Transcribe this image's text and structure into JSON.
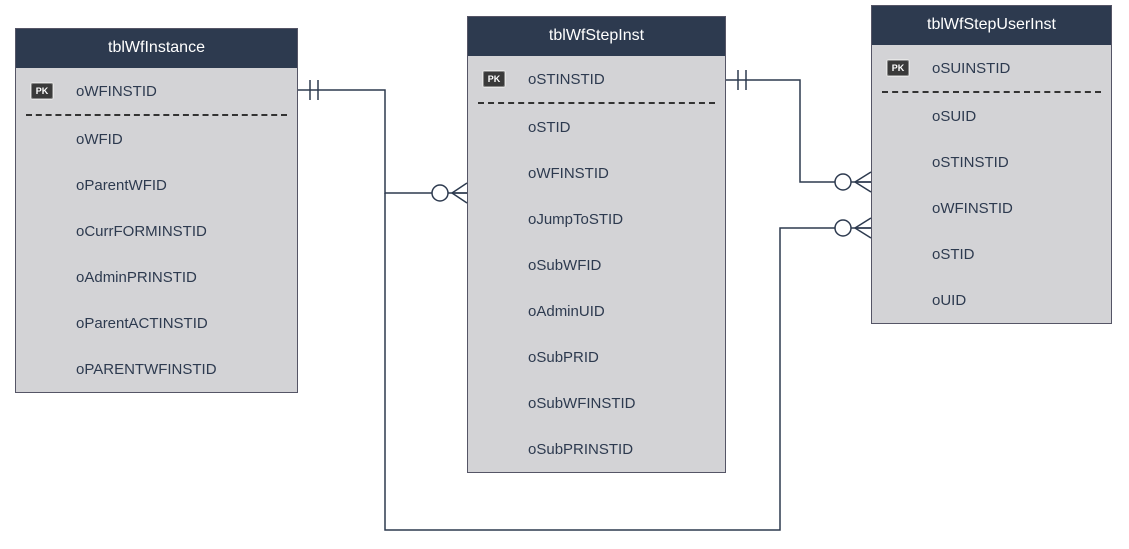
{
  "entities": {
    "wfInstance": {
      "title": "tblWfInstance",
      "pk": "oWFINSTID",
      "cols": [
        "oWFID",
        "oParentWFID",
        "oCurrFORMINSTID",
        "oAdminPRINSTID",
        "oParentACTINSTID",
        "oPARENTWFINSTID"
      ]
    },
    "wfStepInst": {
      "title": "tblWfStepInst",
      "pk": "oSTINSTID",
      "cols": [
        "oSTID",
        "oWFINSTID",
        "oJumpToSTID",
        "oSubWFID",
        "oAdminUID",
        "oSubPRID",
        "oSubWFINSTID",
        "oSubPRINSTID"
      ]
    },
    "wfStepUserInst": {
      "title": "tblWfStepUserInst",
      "pk": "oSUINSTID",
      "cols": [
        "oSUID",
        "oSTINSTID",
        "oWFINSTID",
        "oSTID",
        "oUID"
      ]
    }
  },
  "relations": [
    {
      "from": "wfInstance.oWFINSTID",
      "to": "wfStepInst.oWFINSTID",
      "type": "one-to-many"
    },
    {
      "from": "wfStepInst.oSTINSTID",
      "to": "wfStepUserInst.oSTINSTID",
      "type": "one-to-many"
    },
    {
      "from": "wfInstance.oWFINSTID",
      "to": "wfStepUserInst.oWFINSTID",
      "type": "one-to-many"
    }
  ]
}
